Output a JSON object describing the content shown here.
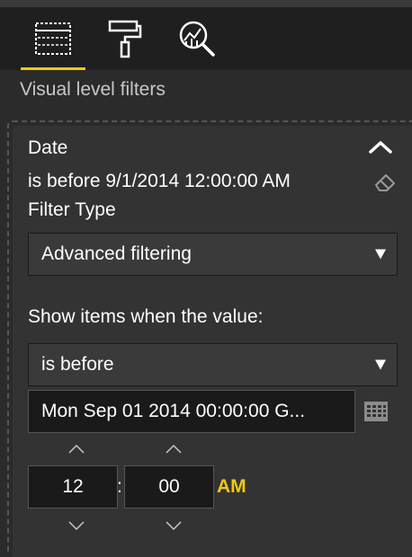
{
  "toolbar": {
    "tabs": [
      {
        "name": "fields",
        "icon": "fields-table-icon"
      },
      {
        "name": "format",
        "icon": "paint-roller-icon"
      },
      {
        "name": "analytics",
        "icon": "analytics-magnifier-icon"
      }
    ],
    "active_tab": "fields",
    "accent_color": "#f2c811"
  },
  "section_header": "Visual level filters",
  "filter_card": {
    "field_name": "Date",
    "summary": "is before 9/1/2014 12:00:00 AM",
    "filter_type_label": "Filter Type",
    "filter_type_value": "Advanced filtering",
    "show_items_label": "Show items when the value:",
    "condition_value": "is before",
    "date_value": "Mon Sep 01 2014 00:00:00 G...",
    "time": {
      "hour": "12",
      "separator": ":",
      "minute": "00",
      "ampm": "AM"
    },
    "icons": {
      "collapse": "chevron-up-icon",
      "clear": "eraser-icon",
      "calendar": "calendar-icon"
    }
  }
}
